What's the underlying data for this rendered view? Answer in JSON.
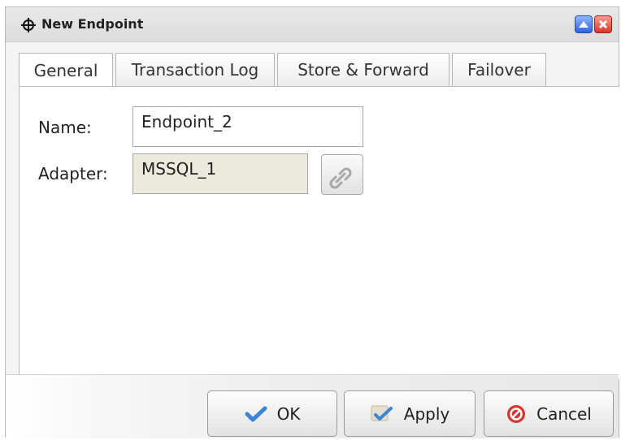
{
  "window": {
    "title": "New Endpoint",
    "icons": [
      "crosshair-icon",
      "maximize-icon",
      "close-icon"
    ]
  },
  "tabs": [
    {
      "label": "General",
      "active": true
    },
    {
      "label": "Transaction Log",
      "active": false
    },
    {
      "label": "Store & Forward",
      "active": false
    },
    {
      "label": "Failover",
      "active": false
    }
  ],
  "form": {
    "name_label": "Name:",
    "name_value": "Endpoint_2",
    "adapter_label": "Adapter:",
    "adapter_value": "MSSQL_1",
    "adapter_action_icon": "link-icon"
  },
  "buttons": {
    "ok": "OK",
    "apply": "Apply",
    "cancel": "Cancel"
  },
  "colors": {
    "adapter_field_bg": "#ece9dd",
    "ok_check": "#3a86d6",
    "cancel_red": "#d9362b"
  }
}
